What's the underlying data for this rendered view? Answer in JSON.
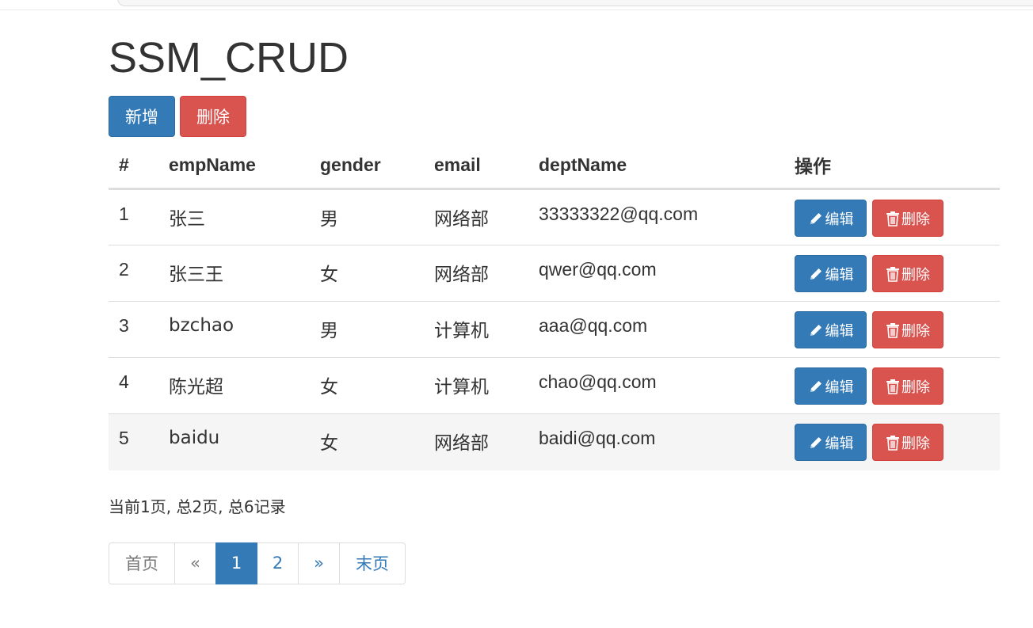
{
  "page": {
    "title": "SSM_CRUD"
  },
  "toolbar": {
    "add_label": "新增",
    "delete_label": "删除"
  },
  "colors": {
    "primary": "#337ab7",
    "danger": "#d9534f",
    "text": "#333333",
    "border": "#dddddd",
    "row_hover": "#f5f5f5"
  },
  "table": {
    "headers": [
      "#",
      "empName",
      "gender",
      "email",
      "deptName",
      "操作"
    ],
    "rows": [
      {
        "num": "1",
        "name": "张三",
        "gender": "男",
        "email": "网络部",
        "dept": "33333322@qq.com"
      },
      {
        "num": "2",
        "name": "张三王",
        "gender": "女",
        "email": "网络部",
        "dept": "qwer@qq.com"
      },
      {
        "num": "3",
        "name": "bzchao",
        "gender": "男",
        "email": "计算机",
        "dept": "aaa@qq.com"
      },
      {
        "num": "4",
        "name": "陈光超",
        "gender": "女",
        "email": "计算机",
        "dept": "chao@qq.com"
      },
      {
        "num": "5",
        "name": "baidu",
        "gender": "女",
        "email": "网络部",
        "dept": "baidi@qq.com"
      }
    ],
    "edit_label": "编辑",
    "delete_label": "删除",
    "edit_icon": "pencil-icon",
    "delete_icon": "trash-icon"
  },
  "pagination": {
    "info": "当前1页, 总2页, 总6记录",
    "first": "首页",
    "prev": "«",
    "pages": [
      "1",
      "2"
    ],
    "active_page": "1",
    "next": "»",
    "last": "末页"
  }
}
